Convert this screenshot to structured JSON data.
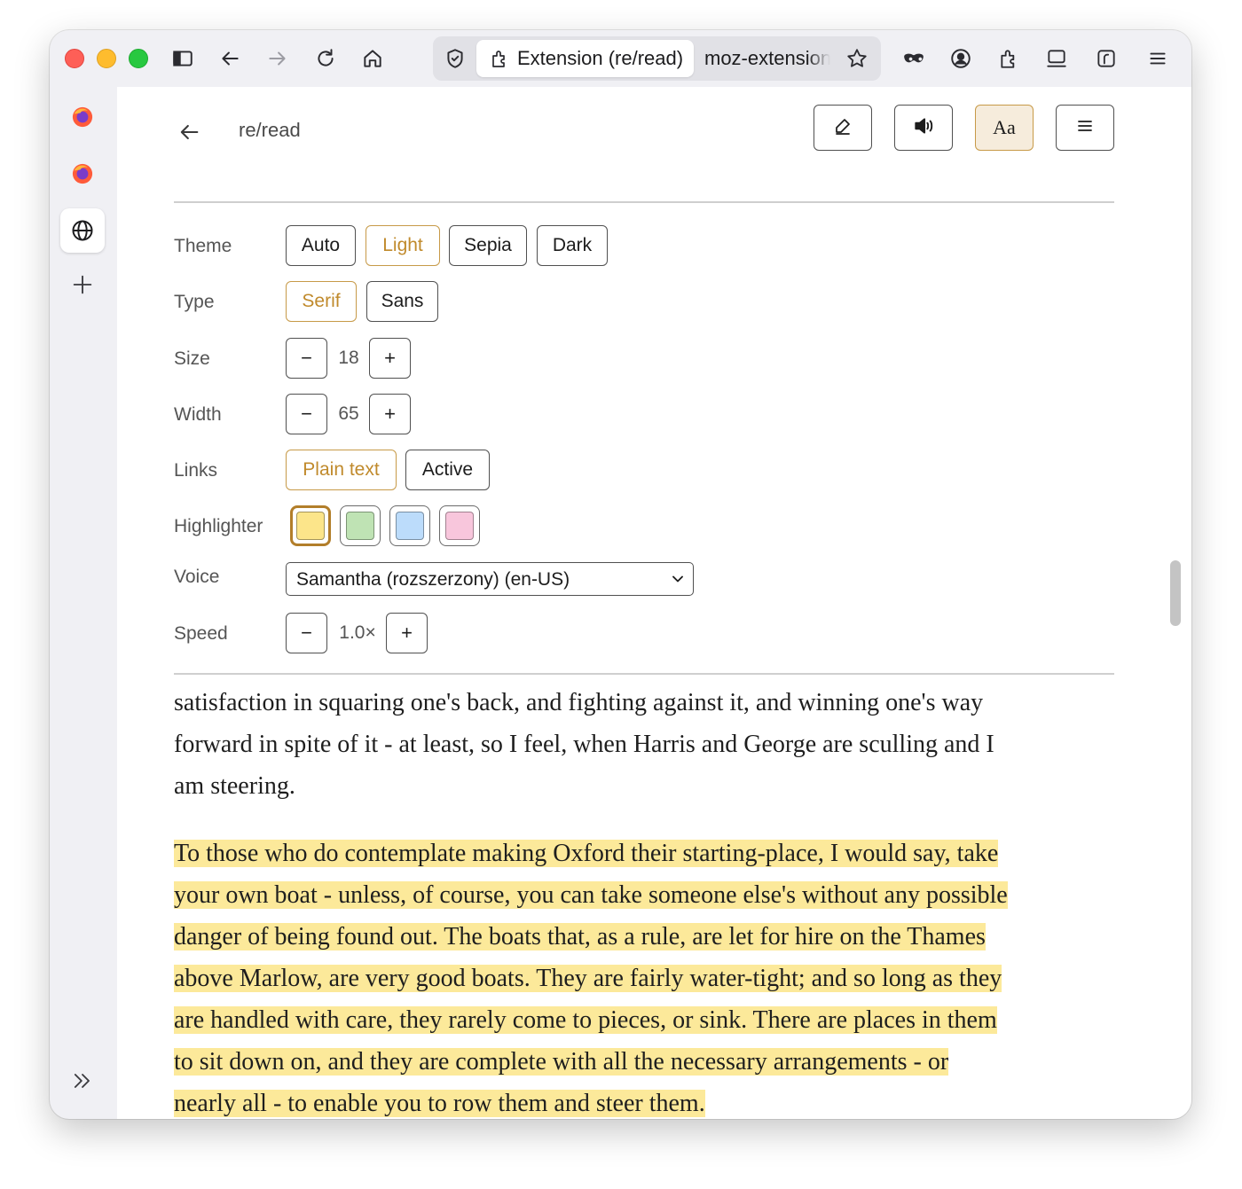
{
  "browser": {
    "tab_label": "Extension (re/read)",
    "url": "moz-extension://",
    "toolbar_icons": [
      "sidebar-icon",
      "back-arrow-icon",
      "forward-arrow-icon",
      "reload-icon",
      "home-icon",
      "shield-icon",
      "bookmark-star-icon",
      "private-mask-icon",
      "account-icon",
      "extensions-icon",
      "synced-tabs-icon",
      "firefox-view-icon",
      "menu-icon"
    ],
    "sidebar_icons": [
      "firefox-icon",
      "firefox-icon",
      "globe-icon",
      "plus-icon",
      "expand-icon"
    ]
  },
  "header": {
    "title": "re/read",
    "buttons": [
      "edit-icon",
      "speaker-icon",
      "Aa",
      "menu-icon"
    ],
    "aa_label": "Aa"
  },
  "settings": {
    "theme": {
      "label": "Theme",
      "options": [
        "Auto",
        "Light",
        "Sepia",
        "Dark"
      ],
      "selected": "Light"
    },
    "type": {
      "label": "Type",
      "options": [
        "Serif",
        "Sans"
      ],
      "selected": "Serif"
    },
    "size": {
      "label": "Size",
      "value": "18",
      "minus": "−",
      "plus": "+"
    },
    "width": {
      "label": "Width",
      "value": "65",
      "minus": "−",
      "plus": "+"
    },
    "links": {
      "label": "Links",
      "options": [
        "Plain text",
        "Active"
      ],
      "selected": "Plain text"
    },
    "highlighter": {
      "label": "Highlighter",
      "colors": [
        "#fce58a",
        "#bfe3b4",
        "#bcdcfb",
        "#f8c6dc"
      ],
      "selected": 0
    },
    "voice": {
      "label": "Voice",
      "value": "Samantha (rozszerzony) (en-US)"
    },
    "speed": {
      "label": "Speed",
      "value": "1.0×",
      "minus": "−",
      "plus": "+"
    }
  },
  "reading": {
    "para1_lines": [
      "satisfaction in squaring one's back, and fighting against it, and winning one's way",
      "forward in spite of it - at least, so I feel, when Harris and George are sculling and I",
      "am steering."
    ],
    "para2_lines": [
      "To those who do contemplate making Oxford their starting-place, I would say, take",
      "your own boat - unless, of course, you can take someone else's without any possible",
      "danger of being found out. The boats that, as a rule, are let for hire on the Thames",
      "above Marlow, are very good boats. They are fairly water-tight; and so long as they",
      "are handled with care, they rarely come to pieces, or sink. There are places in them",
      "to sit down on, and they are complete with all the necessary arrangements - or",
      "nearly all - to enable you to row them and steer them."
    ],
    "highlight_color": "#fce99a"
  }
}
